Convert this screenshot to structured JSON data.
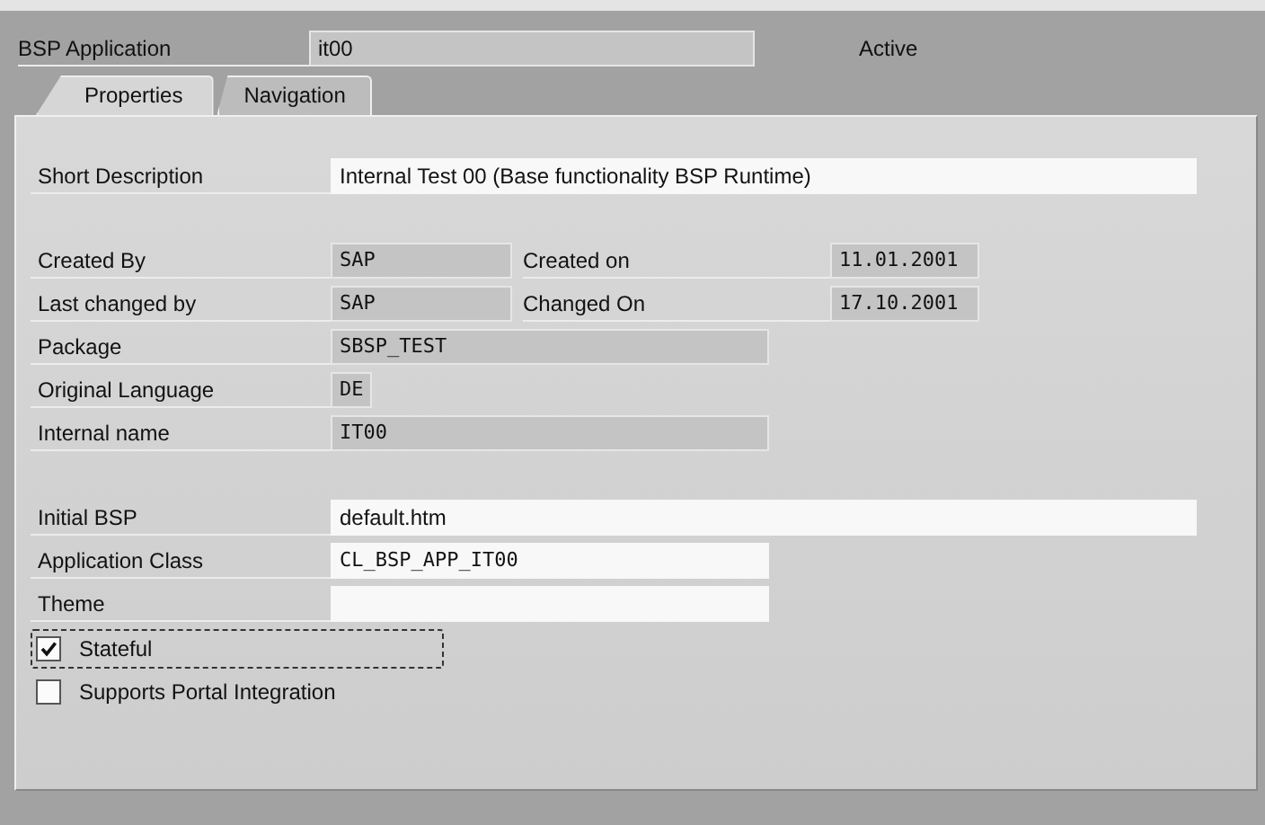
{
  "header": {
    "label": "BSP Application",
    "value": "it00",
    "status": "Active"
  },
  "tabs": [
    {
      "label": "Properties",
      "selected": true
    },
    {
      "label": "Navigation",
      "selected": false
    }
  ],
  "groups": [
    [
      {
        "label": "Short Description",
        "value": "Internal Test 00 (Base functionality BSP Runtime)",
        "readonly": false,
        "monospace": false
      }
    ],
    [
      {
        "label": "Created By",
        "value": "SAP",
        "readonly": true,
        "monospace": true,
        "side": {
          "label": "Created on",
          "value": "11.01.2001",
          "readonly": true,
          "monospace": true
        }
      },
      {
        "label": "Last changed by",
        "value": "SAP",
        "readonly": true,
        "monospace": true,
        "side": {
          "label": "Changed On",
          "value": "17.10.2001",
          "readonly": true,
          "monospace": true
        }
      },
      {
        "label": "Package",
        "value": "SBSP_TEST",
        "readonly": true,
        "monospace": true
      },
      {
        "label": "Original Language",
        "value": "DE",
        "readonly": true,
        "monospace": true
      },
      {
        "label": "Internal name",
        "value": "IT00",
        "readonly": true,
        "monospace": true
      }
    ],
    [
      {
        "label": "Initial BSP",
        "value": "default.htm",
        "readonly": false,
        "monospace": false
      },
      {
        "label": "Application Class",
        "value": "CL_BSP_APP_IT00",
        "readonly": false,
        "monospace": true
      },
      {
        "label": "Theme",
        "readonly": false
      }
    ]
  ],
  "checkboxes": [
    {
      "label": "Stateful",
      "checked": true,
      "focused": true
    },
    {
      "label": "Supports Portal Integration",
      "checked": false,
      "focused": false
    }
  ]
}
